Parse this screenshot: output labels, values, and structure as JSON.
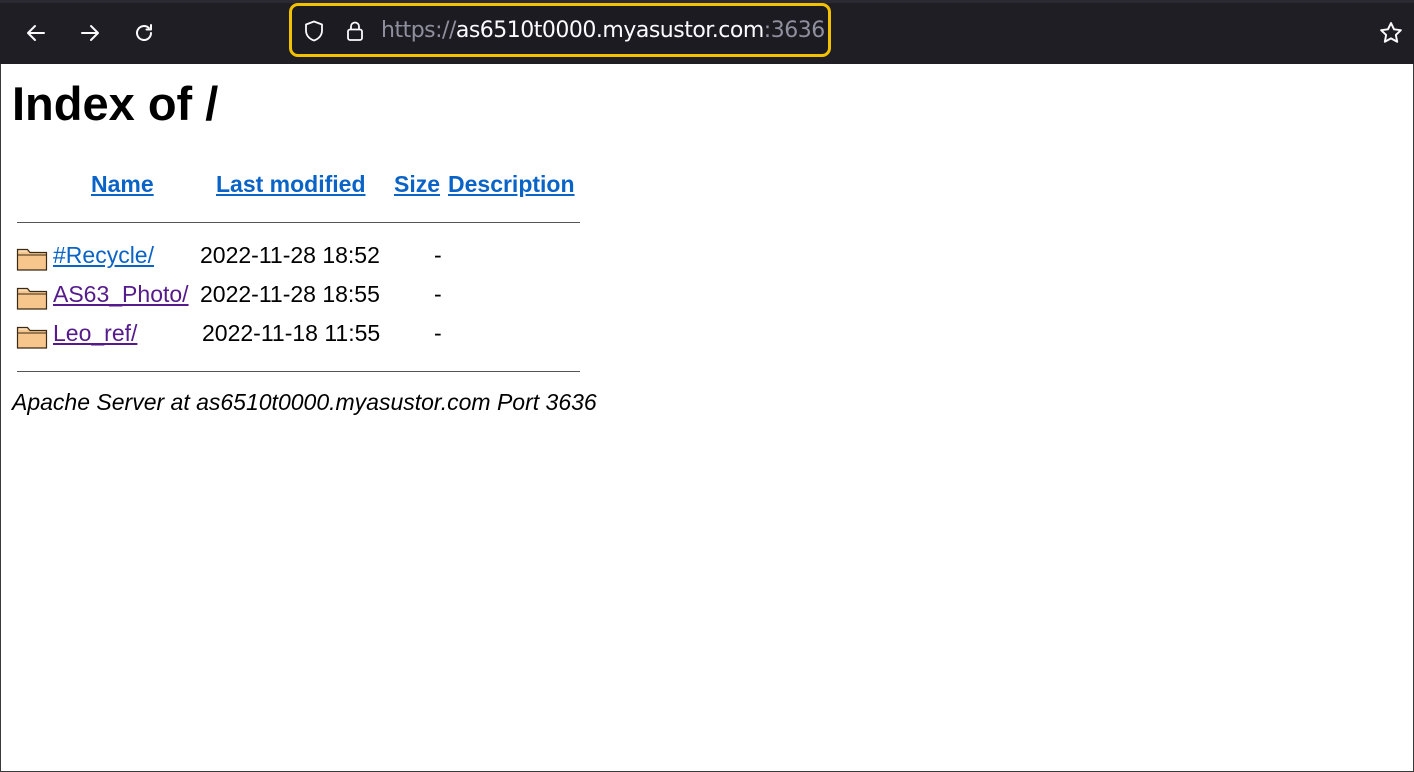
{
  "browser": {
    "url": {
      "scheme": "https://",
      "host": "as6510t0000.myasustor.com",
      "port": ":3636"
    },
    "colors": {
      "toolbar": "#1f1e25",
      "focus_ring": "#f2c200"
    }
  },
  "page": {
    "title": "Index of /",
    "columns": {
      "name": "Name",
      "last_modified": "Last modified",
      "size": "Size",
      "description": "Description"
    },
    "rows": [
      {
        "name": "#Recycle/",
        "modified": "2022-11-28 18:52",
        "size": "-",
        "visited": false
      },
      {
        "name": "AS63_Photo/",
        "modified": "2022-11-28 18:55",
        "size": "-",
        "visited": true
      },
      {
        "name": "Leo_ref/",
        "modified": "2022-11-18 11:55",
        "size": "-",
        "visited": true
      }
    ],
    "footer": "Apache Server at as6510t0000.myasustor.com Port 3636"
  }
}
